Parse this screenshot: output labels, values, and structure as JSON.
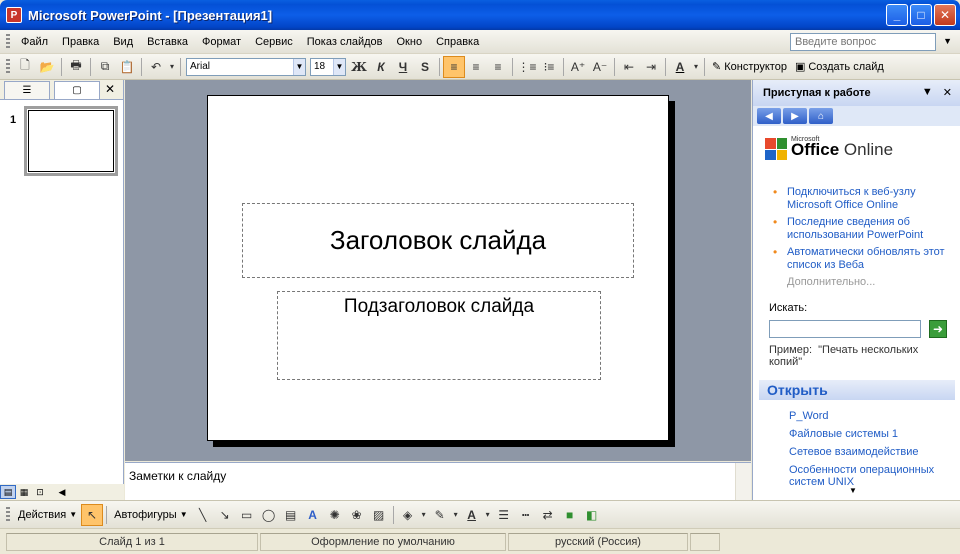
{
  "window": {
    "title": "Microsoft PowerPoint - [Презентация1]",
    "app_icon": "P",
    "controls": {
      "minimize": "_",
      "maximize": "□",
      "close": "✕"
    }
  },
  "menubar": {
    "items": [
      "Файл",
      "Правка",
      "Вид",
      "Вставка",
      "Формат",
      "Сервис",
      "Показ слайдов",
      "Окно",
      "Справка"
    ],
    "ask_placeholder": "Введите вопрос"
  },
  "toolbar": {
    "font_name": "Arial",
    "font_size": "18",
    "bold": "Ж",
    "italic": "К",
    "underline": "Ч",
    "shadow": "S",
    "designer_label": "Конструктор",
    "new_slide_label": "Создать слайд"
  },
  "left_panel": {
    "slide_number": "1"
  },
  "slide": {
    "title": "Заголовок слайда",
    "subtitle": "Подзаголовок слайда"
  },
  "notes": {
    "placeholder": "Заметки к слайду"
  },
  "task_pane": {
    "title": "Приступая к работе",
    "logo_super": "Microsoft",
    "logo_main": "Office",
    "logo_rest": "Online",
    "links": [
      "Подключиться к веб-узлу Microsoft Office Online",
      "Последние сведения об использовании PowerPoint",
      "Автоматически обновлять этот список из Веба"
    ],
    "more": "Дополнительно...",
    "search_label": "Искать:",
    "example_label": "Пример:",
    "example_text": "\"Печать нескольких копий\"",
    "open_header": "Открыть",
    "open_items": [
      "P_Word",
      "Файловые системы 1",
      "Сетевое взаимодействие",
      "Особенности операционных систем UNIX"
    ]
  },
  "drawbar": {
    "actions_label": "Действия",
    "autoshapes_label": "Автофигуры"
  },
  "statusbar": {
    "slide_info": "Слайд 1 из 1",
    "design": "Оформление по умолчанию",
    "language": "русский (Россия)"
  }
}
